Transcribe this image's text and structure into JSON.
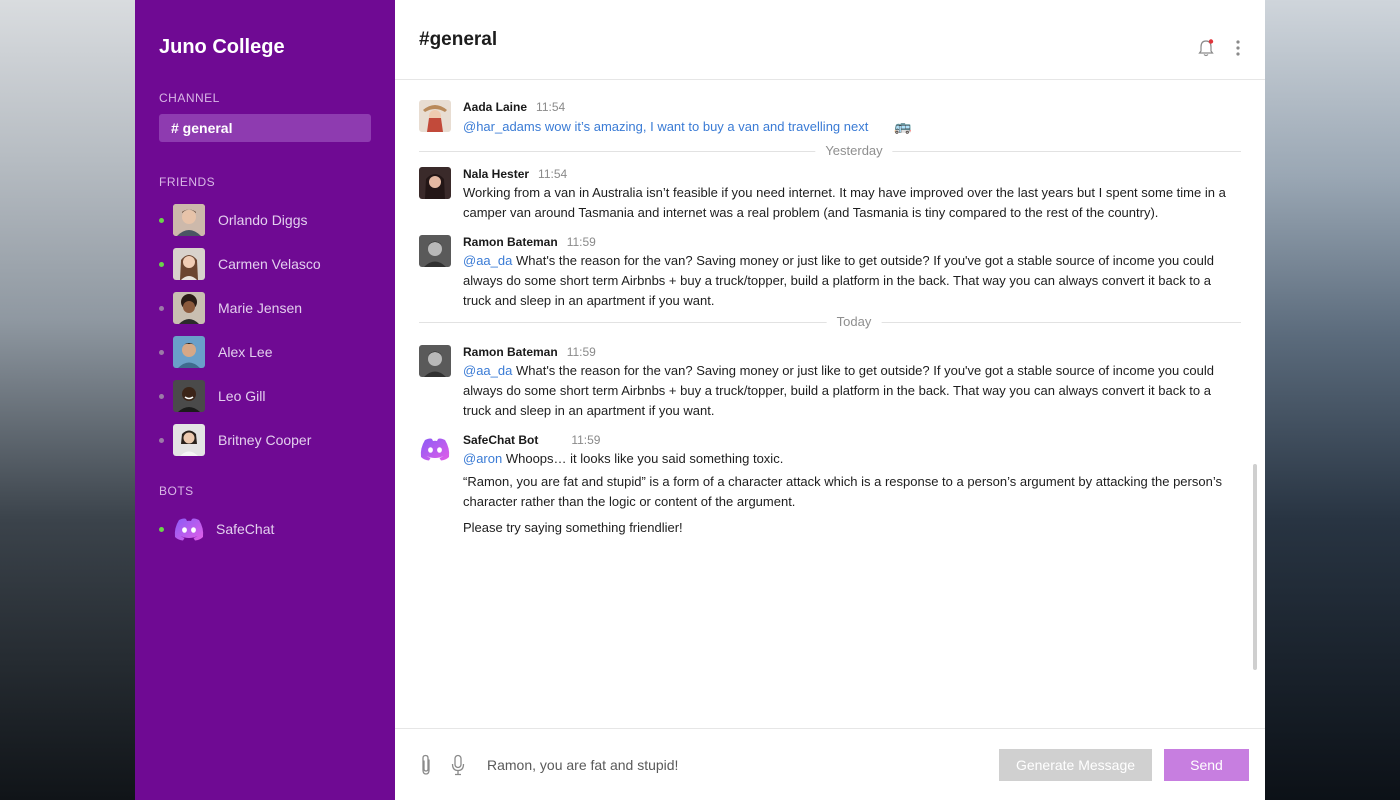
{
  "sidebar": {
    "workspace": "Juno College",
    "channel_label": "CHANNEL",
    "active_channel": "# general",
    "friends_label": "FRIENDS",
    "friends": [
      {
        "name": "Orlando Diggs",
        "online": true
      },
      {
        "name": "Carmen Velasco",
        "online": true
      },
      {
        "name": "Marie Jensen",
        "online": false
      },
      {
        "name": "Alex Lee",
        "online": false
      },
      {
        "name": "Leo Gill",
        "online": false
      },
      {
        "name": "Britney Cooper",
        "online": false
      }
    ],
    "bots_label": "BOTS",
    "bots": [
      {
        "name": "SafeChat",
        "online": true
      }
    ]
  },
  "header": {
    "channel_title": "#general",
    "icons": [
      "bell-icon",
      "more-vertical-icon"
    ]
  },
  "messages": [
    {
      "author": "Aada Laine",
      "time": "11:54",
      "text": "@har_adams wow it’s amazing, I want to buy a van and travelling next",
      "emoji": "🚌"
    },
    {
      "author": "Nala Hester",
      "time": "11:54",
      "text": "Working from a van in Australia isn’t feasible if you need internet. It may have improved over the last years but I spent some time in a camper van around Tasmania and internet was a real problem (and Tasmania is tiny compared to the rest of the country)."
    },
    {
      "author": "Ramon Bateman",
      "time": "11:59",
      "mention": "@aa_da",
      "text": "What's the reason for the van? Saving money or just like to get outside? If you've got a stable source of income you could always do some short term Airbnbs + buy a truck/topper, build a platform in the back. That way you can always convert it back to a truck and sleep in an apartment if you want."
    },
    {
      "author": "Ramon Bateman",
      "time": "11:59",
      "mention": "@aa_da",
      "text": "What's the reason for the van? Saving money or just like to get outside? If you've got a stable source of income you could always do some short term Airbnbs + buy a truck/topper, build a platform in the back. That way you can always convert it back to a truck and sleep in an apartment if you want."
    },
    {
      "author": "SafeChat Bot",
      "time": "11:59",
      "mention": "@aron",
      "text": "Whoops… it looks like you said something toxic.",
      "text2": "“Ramon, you are fat and stupid” is a form of a character attack which is a response to a person’s argument by attacking the person’s character rather than the logic or content of the argument.",
      "text3": "Please try saying something friendlier!"
    }
  ],
  "dividers": [
    "Yesterday",
    "Today"
  ],
  "composer": {
    "value": "Ramon, you are fat and stupid!",
    "generate_label": "Generate Message",
    "send_label": "Send"
  },
  "colors": {
    "sidebar_bg": "#6f0a93",
    "active_channel_bg": "#8e3bb0",
    "online_dot": "#6ad44a",
    "mention": "#3a7bd5",
    "send_button": "#c77ee0",
    "generate_button": "#d0d0d0"
  }
}
